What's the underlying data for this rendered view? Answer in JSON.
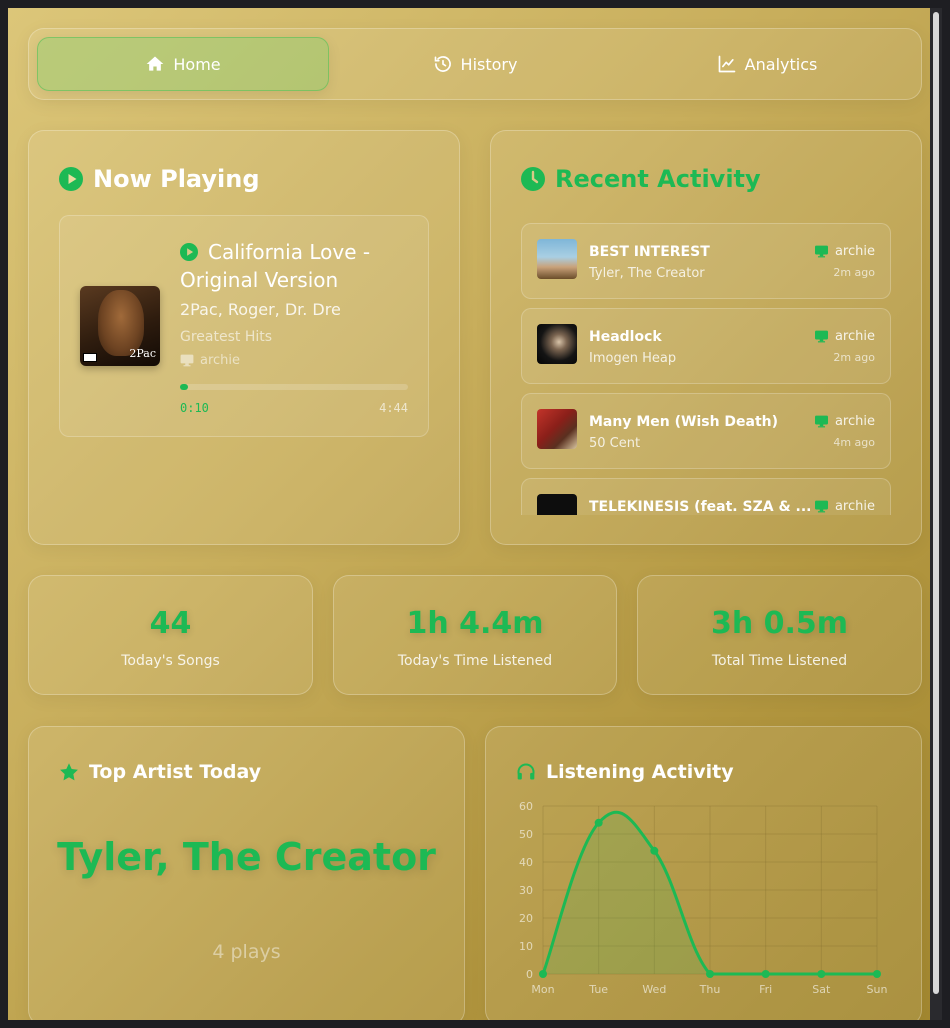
{
  "colors": {
    "accent": "#1db954",
    "background_start": "#dcc679",
    "background_end": "#a38830"
  },
  "nav": {
    "items": [
      {
        "label": "Home",
        "icon": "home-icon",
        "active": true
      },
      {
        "label": "History",
        "icon": "history-icon",
        "active": false
      },
      {
        "label": "Analytics",
        "icon": "chart-line-icon",
        "active": false
      }
    ]
  },
  "now_playing": {
    "title": "Now Playing",
    "track": "California Love - Original Version",
    "artists": "2Pac, Roger, Dr. Dre",
    "album": "Greatest Hits",
    "device": "archie",
    "cover_text": "2Pac",
    "current_time": "0:10",
    "total_time": "4:44",
    "progress": 0.035
  },
  "recent_activity": {
    "title": "Recent Activity",
    "items": [
      {
        "song": "BEST INTEREST",
        "artist": "Tyler, The Creator",
        "device": "archie",
        "time": "2m ago"
      },
      {
        "song": "Headlock",
        "artist": "Imogen Heap",
        "device": "archie",
        "time": "2m ago"
      },
      {
        "song": "Many Men (Wish Death)",
        "artist": "50 Cent",
        "device": "archie",
        "time": "4m ago"
      },
      {
        "song": "TELEKINESIS (feat. SZA & ...",
        "artist": "",
        "device": "archie",
        "time": ""
      }
    ]
  },
  "stats": [
    {
      "value": "44",
      "label": "Today's Songs"
    },
    {
      "value": "1h 4.4m",
      "label": "Today's Time Listened"
    },
    {
      "value": "3h 0.5m",
      "label": "Total Time Listened"
    }
  ],
  "top_artist": {
    "title": "Top Artist Today",
    "name": "Tyler, The Creator",
    "plays": "4 plays"
  },
  "listening_activity": {
    "title": "Listening Activity"
  },
  "chart_data": {
    "type": "line",
    "categories": [
      "Mon",
      "Tue",
      "Wed",
      "Thu",
      "Fri",
      "Sat",
      "Sun"
    ],
    "series": [
      {
        "values": [
          0,
          54,
          44,
          0,
          0,
          0,
          0
        ]
      }
    ],
    "ylim": [
      0,
      60
    ],
    "yticks": [
      0,
      10,
      20,
      30,
      40,
      50,
      60
    ],
    "title": "",
    "xlabel": "",
    "ylabel": "",
    "grid": true,
    "smooth": true,
    "fill": true
  }
}
